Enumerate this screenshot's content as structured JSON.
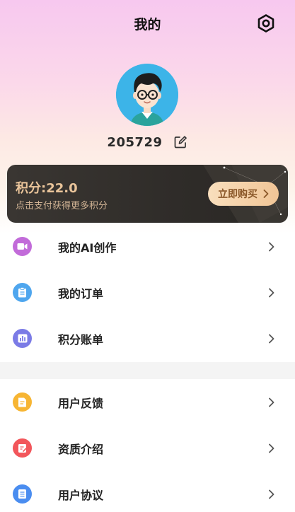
{
  "header": {
    "title": "我的"
  },
  "profile": {
    "user_id": "205729"
  },
  "points_card": {
    "points_text": "积分:22.0",
    "hint": "点击支付获得更多积分",
    "buy_label": "立即购买"
  },
  "menu_group_1": [
    {
      "label": "我的AI创作",
      "icon": "video-icon",
      "color": "#c26bd9"
    },
    {
      "label": "我的订单",
      "icon": "clipboard-icon",
      "color": "#4fa6ee"
    },
    {
      "label": "积分账单",
      "icon": "bar-chart-icon",
      "color": "#7b7be6"
    }
  ],
  "menu_group_2": [
    {
      "label": "用户反馈",
      "icon": "feedback-icon",
      "color": "#f7b533"
    },
    {
      "label": "资质介绍",
      "icon": "certificate-icon",
      "color": "#f2565b"
    },
    {
      "label": "用户协议",
      "icon": "document-icon",
      "color": "#4a8df0"
    }
  ],
  "colors": {
    "accent_gold": "#e9c49a",
    "card_dark": "#2f2c29",
    "avatar_bg": "#3cb4e8"
  }
}
